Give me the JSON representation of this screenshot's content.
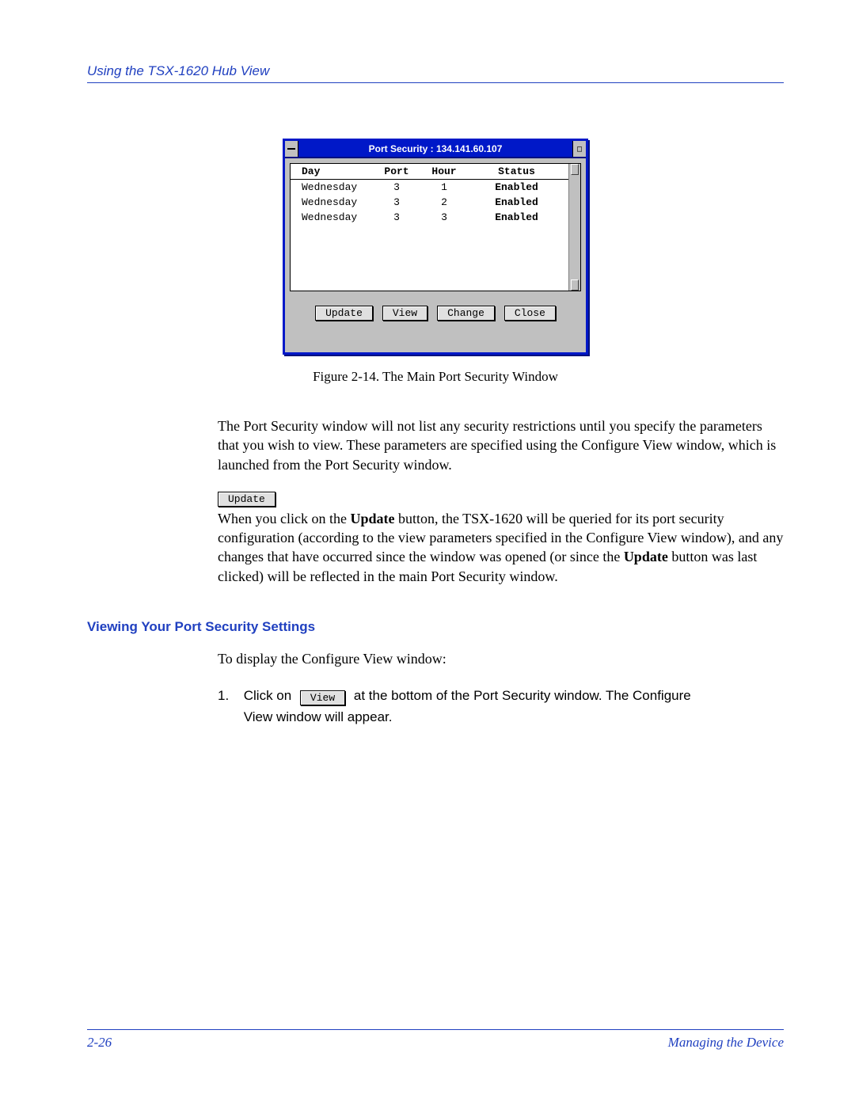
{
  "header": {
    "running_head": "Using the TSX-1620 Hub View"
  },
  "window": {
    "title": "Port Security : 134.141.60.107",
    "columns": {
      "day": "Day",
      "port": "Port",
      "hour": "Hour",
      "status": "Status"
    },
    "rows": [
      {
        "day": "Wednesday",
        "port": "3",
        "hour": "1",
        "status": "Enabled"
      },
      {
        "day": "Wednesday",
        "port": "3",
        "hour": "2",
        "status": "Enabled"
      },
      {
        "day": "Wednesday",
        "port": "3",
        "hour": "3",
        "status": "Enabled"
      }
    ],
    "buttons": {
      "update": "Update",
      "view": "View",
      "change": "Change",
      "close": "Close"
    }
  },
  "figure_caption": "Figure 2-14. The Main Port Security Window",
  "para1": "The Port Security window will not list any security restrictions until you specify the parameters that you wish to view. These parameters are specified using the Configure View window, which is launched from the Port Security window.",
  "update_btn_label": "Update",
  "para2_pre": "When you click on the ",
  "para2_bold1": "Update",
  "para2_mid": " button, the TSX-1620 will be queried for its port security configuration (according to the view parameters specified in the Configure View window), and any changes that have occurred since the window was opened (or since the ",
  "para2_bold2": "Update",
  "para2_post": " button was last clicked) will be reflected in the main Port Security window.",
  "section_head": "Viewing Your Port Security Settings",
  "para3": "To display the Configure View window:",
  "step1_num": "1.",
  "step1_pre": "Click on ",
  "step1_btn": "View",
  "step1_post": " at the bottom of the Port Security window. The Configure View window will appear.",
  "footer": {
    "page": "2-26",
    "chapter": "Managing the Device"
  }
}
